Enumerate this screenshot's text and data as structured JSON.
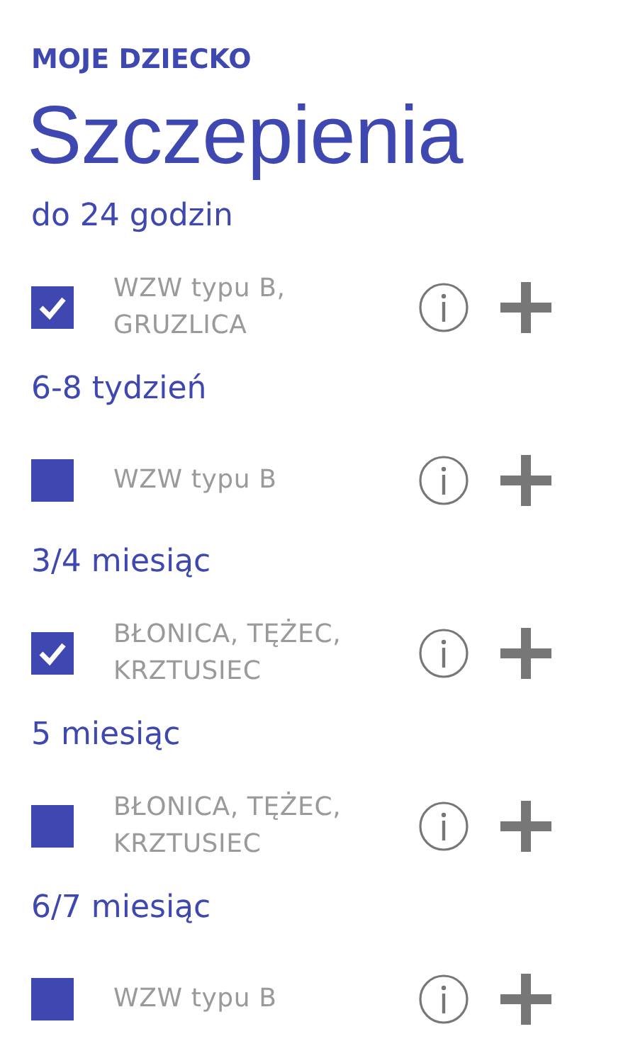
{
  "app_title": "MOJE DZIECKO",
  "page_title": "Szczepienia",
  "groups": [
    {
      "heading": "do 24 godzin",
      "vaccines": [
        {
          "name": "WZW typu B,\nGRUZLICA",
          "checked": true
        }
      ]
    },
    {
      "heading": "6-8 tydzień",
      "vaccines": [
        {
          "name": "WZW typu B",
          "checked": false
        }
      ]
    },
    {
      "heading": "3/4 miesiąc",
      "vaccines": [
        {
          "name": "BŁONICA, TĘŻEC,\nKRZTUSIEC",
          "checked": true
        }
      ]
    },
    {
      "heading": "5 miesiąc",
      "vaccines": [
        {
          "name": "BŁONICA, TĘŻEC,\nKRZTUSIEC",
          "checked": false
        }
      ]
    },
    {
      "heading": "6/7 miesiąc",
      "vaccines": [
        {
          "name": "WZW typu B",
          "checked": false
        }
      ]
    }
  ]
}
